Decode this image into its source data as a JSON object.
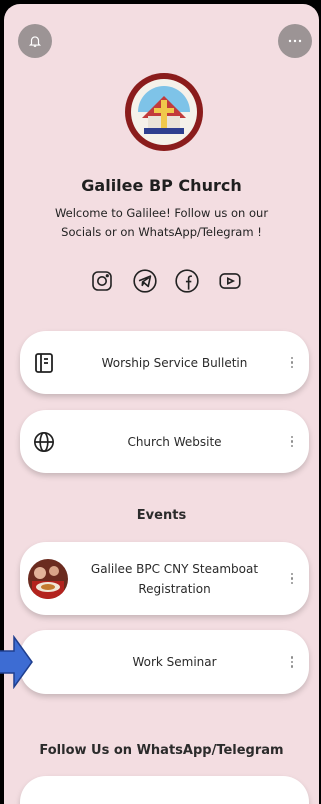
{
  "header": {
    "bell_icon": "bell-icon",
    "more_icon": "more-horizontal-icon"
  },
  "profile": {
    "name": "Galilee BP Church",
    "description": "Welcome to Galilee! Follow us on our Socials or on WhatsApp/Telegram !"
  },
  "socials": [
    "instagram-icon",
    "telegram-icon",
    "facebook-icon",
    "youtube-icon"
  ],
  "links": [
    {
      "label": "Worship Service Bulletin",
      "icon": "bulletin-icon"
    },
    {
      "label": "Church Website",
      "icon": "globe-icon"
    }
  ],
  "events": {
    "heading": "Events",
    "items": [
      {
        "label": "Galilee BPC CNY Steamboat Registration",
        "thumb": "event-photo"
      },
      {
        "label": "Work Seminar"
      }
    ]
  },
  "follow": {
    "heading": "Follow Us on WhatsApp/Telegram"
  },
  "colors": {
    "background": "#f3dde1",
    "card": "#ffffff",
    "accent_arrow": "#3d6cd3"
  }
}
